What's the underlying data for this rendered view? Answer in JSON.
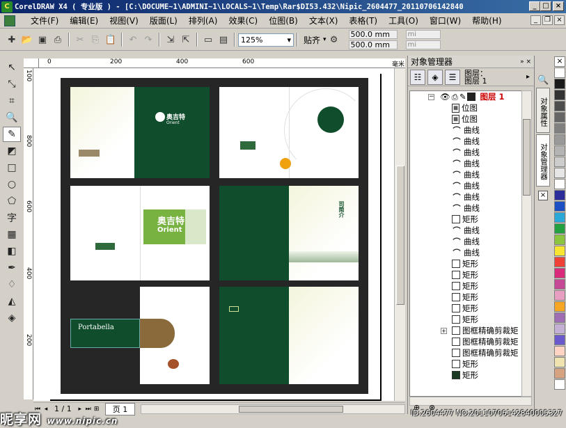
{
  "window": {
    "title": "CorelDRAW X4 ( 专业版 ) - [C:\\DOCUME~1\\ADMINI~1\\LOCALS~1\\Temp\\Rar$DI53.432\\Nipic_2604477_20110706142840"
  },
  "menu": {
    "items": [
      "文件(F)",
      "编辑(E)",
      "视图(V)",
      "版面(L)",
      "排列(A)",
      "效果(C)",
      "位图(B)",
      "文本(X)",
      "表格(T)",
      "工具(O)",
      "窗口(W)",
      "帮助(H)"
    ]
  },
  "toolbar": {
    "zoom": "125%",
    "snap_label": "贴齐",
    "width_value": "500.0 mm",
    "height_value": "500.0 mm",
    "unit_x": "mi",
    "unit_y": "mi"
  },
  "ruler": {
    "top_labels": [
      "0",
      "200",
      "400",
      "600"
    ],
    "left_labels": [
      "100",
      "800",
      "600",
      "400",
      "200"
    ],
    "unit": "毫米"
  },
  "page_nav": {
    "page_count": "1 / 1",
    "page_tab": "页 1"
  },
  "canvas": {
    "brand_cn": "奥吉特",
    "brand_en": "Orient",
    "portabella": "Portabella",
    "chapter": "司简介"
  },
  "object_manager": {
    "title": "对象管理器",
    "layer_header_1": "图层：",
    "layer_header_2": "图层 1",
    "layer_name": "图层 1",
    "objects": [
      "位图",
      "位图",
      "曲线",
      "曲线",
      "曲线",
      "曲线",
      "曲线",
      "曲线",
      "曲线",
      "曲线",
      "矩形",
      "曲线",
      "曲线",
      "曲线",
      "矩形",
      "矩形",
      "矩形",
      "矩形",
      "矩形",
      "矩形",
      "图框精确剪裁矩",
      "图框精确剪裁矩",
      "图框精确剪裁矩",
      "矩形",
      "矩形"
    ]
  },
  "docker_tabs": [
    "对象属性",
    "对象管理器"
  ],
  "palette": {
    "colors": [
      "#ffffff",
      "#1a1a1a",
      "#333333",
      "#4d4d4d",
      "#666666",
      "#808080",
      "#999999",
      "#b3b3b3",
      "#cccccc",
      "#e6e6e6",
      "#ffffff",
      "#2c2c9a",
      "#1d4fc4",
      "#2aa8d8",
      "#23a040",
      "#8bc53f",
      "#f7e531",
      "#ef4136",
      "#d92b7a",
      "#c54895",
      "#e89ec1",
      "#f5a623",
      "#9e6db3",
      "#c5b0d5",
      "#6a5acd",
      "#ffd4c4",
      "#efe4b0",
      "#d6a380",
      "#ffffff"
    ]
  },
  "watermark": {
    "site": "昵享网",
    "url": "www.nipic.cn",
    "id_text": "ID:2604477 NO:20110706142840005327"
  }
}
